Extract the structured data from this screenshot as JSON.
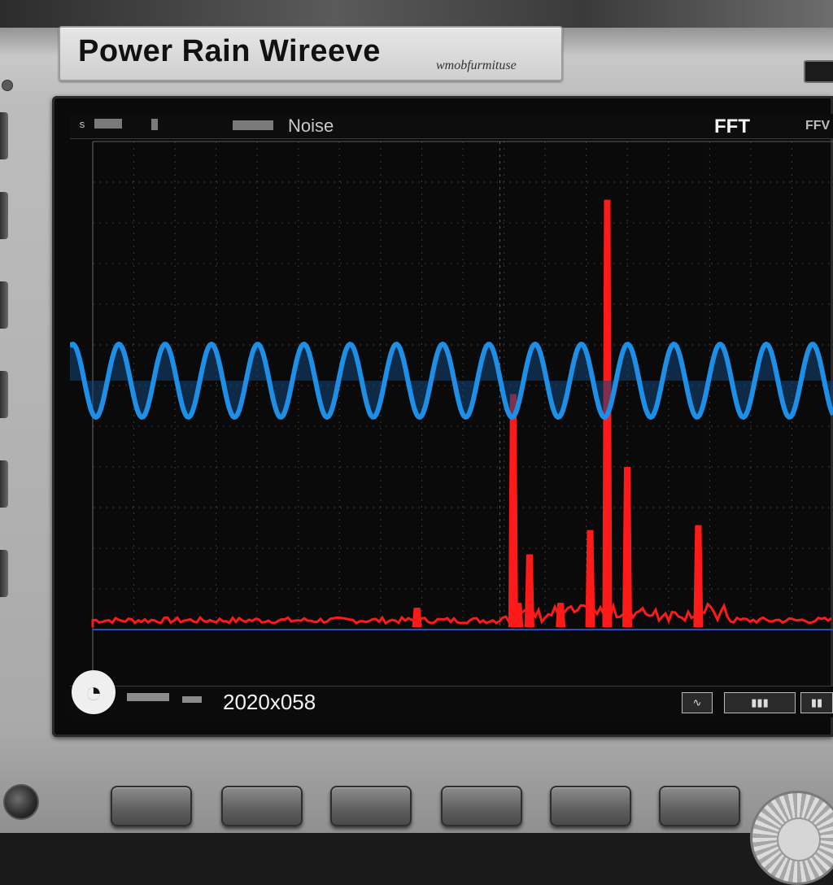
{
  "brand": {
    "title": "Power Rain Wireeve",
    "subtitle": "wmobfurmituse"
  },
  "screen": {
    "top_bar": {
      "noise_label": "Noise",
      "fft_label": "FFT",
      "right_label": "FFV",
      "menu_icon": "s"
    },
    "bottom_bar": {
      "readout": "2020x058",
      "icons": [
        "waveform-icon",
        "bar-icon",
        "bar-icon"
      ]
    }
  },
  "chart_data": {
    "type": "line",
    "title": "",
    "xlabel": "",
    "ylabel": "",
    "xlim": [
      0,
      1
    ],
    "grid": true,
    "series": [
      {
        "name": "Noise",
        "color": "#1e8fe6",
        "kind": "sine",
        "cycles": 16.5,
        "center": 0.49,
        "amplitude": 0.075
      },
      {
        "name": "FFT",
        "color": "#ff1a1a",
        "kind": "spectrum",
        "baseline": 0.0,
        "peaks": [
          {
            "x": 0.568,
            "y": 0.48
          },
          {
            "x": 0.59,
            "y": 0.15
          },
          {
            "x": 0.672,
            "y": 0.2
          },
          {
            "x": 0.695,
            "y": 0.88
          },
          {
            "x": 0.722,
            "y": 0.33
          },
          {
            "x": 0.818,
            "y": 0.21
          },
          {
            "x": 0.438,
            "y": 0.04
          },
          {
            "x": 0.575,
            "y": 0.05
          },
          {
            "x": 0.632,
            "y": 0.05
          }
        ]
      }
    ]
  }
}
